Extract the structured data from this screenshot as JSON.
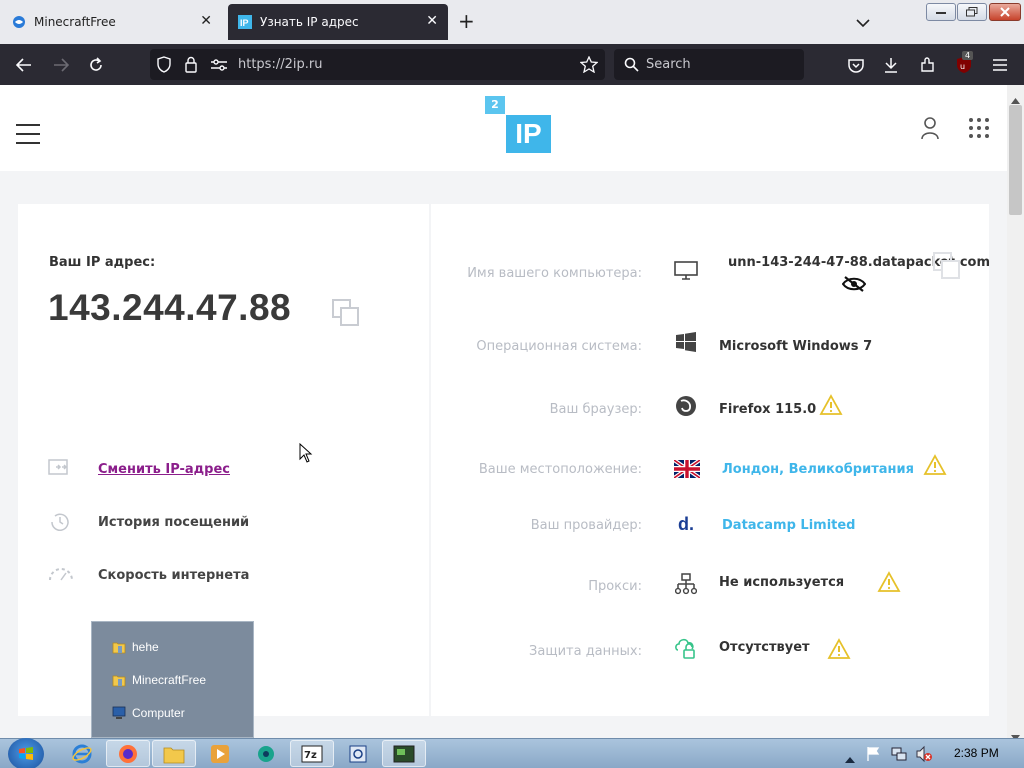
{
  "browser": {
    "tabs": [
      {
        "title": "MinecraftFree",
        "active": false
      },
      {
        "title": "Узнать IP адрес",
        "active": true
      }
    ],
    "url": "https://2ip.ru",
    "search_placeholder": "Search",
    "extension_badge": "4"
  },
  "site": {
    "logo_small": "2",
    "logo_big": "IP",
    "ip_label": "Ваш IP адрес:",
    "ip_value": "143.244.47.88",
    "menu": [
      {
        "label": "Сменить IP-адрес",
        "link": true
      },
      {
        "label": "История посещений",
        "link": false
      },
      {
        "label": "Скорость интернета",
        "link": false
      }
    ],
    "info": [
      {
        "label": "Имя вашего компьютера:",
        "value": "unn-143-244-47-88.datapacket.com",
        "icon": "monitor-icon",
        "warning": false,
        "link": false
      },
      {
        "label": "Операционная система:",
        "value": "Microsoft Windows 7",
        "icon": "windows-icon",
        "warning": false,
        "link": false
      },
      {
        "label": "Ваш браузер:",
        "value": "Firefox 115.0",
        "icon": "browser-icon",
        "warning": true,
        "link": false
      },
      {
        "label": "Ваше местоположение:",
        "value": "Лондон, Великобритания",
        "icon": "uk-flag-icon",
        "warning": true,
        "link": true
      },
      {
        "label": "Ваш провайдер:",
        "value": "Datacamp Limited",
        "icon": "provider-logo-icon",
        "warning": false,
        "link": true
      },
      {
        "label": "Прокси:",
        "value": "Не используется",
        "icon": "proxy-network-icon",
        "warning": true,
        "link": false
      },
      {
        "label": "Защита данных:",
        "value": "Отсутствует",
        "icon": "unlocked-icon",
        "warning": true,
        "link": false
      }
    ]
  },
  "popup": {
    "items": [
      {
        "label": "hehe",
        "icon": "folder-icon"
      },
      {
        "label": "MinecraftFree",
        "icon": "folder-icon"
      },
      {
        "label": "Computer",
        "icon": "computer-icon"
      }
    ]
  },
  "taskbar": {
    "clock": "2:38 PM"
  },
  "colors": {
    "accent": "#3fb6ea",
    "link_purple": "#8b1e8b",
    "warning": "#e6c12a",
    "browser_dark": "#2b2a33"
  }
}
